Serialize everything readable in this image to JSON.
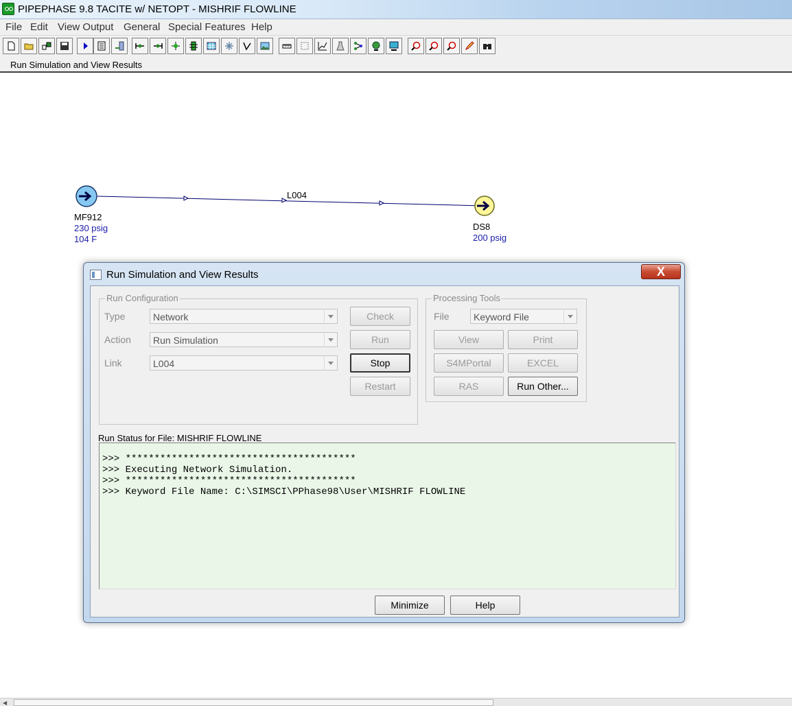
{
  "window": {
    "title": "PIPEPHASE 9.8 TACITE w/ NETOPT - MISHRIF FLOWLINE"
  },
  "menu": [
    "File",
    "Edit",
    "View Output",
    "General",
    "Special Features",
    "Help"
  ],
  "toolbar_icons": [
    "new-file-icon",
    "open-folder-icon",
    "network-icon",
    "save-icon",
    "run-arrow-icon",
    "document-icon",
    "exchange-icon",
    "source-link-icon",
    "sink-link-icon",
    "junction-icon",
    "separator-icon",
    "table-icon",
    "snowflake-icon",
    "link-path-icon",
    "image-icon",
    "ruler-icon",
    "grid-icon",
    "plot-icon",
    "flask-icon",
    "nodes-icon",
    "globe-icon",
    "monitor-icon",
    "zoom-in-icon",
    "zoom-out-icon",
    "zoom-fit-icon",
    "pencil-icon",
    "binoculars-icon"
  ],
  "strip": {
    "label": "Run Simulation and View Results"
  },
  "canvas": {
    "source": {
      "name": "MF912",
      "pressure": "230 psig",
      "temperature": "104 F"
    },
    "link": {
      "name": "L004"
    },
    "sink": {
      "name": "DS8",
      "pressure": "200 psig"
    }
  },
  "dialog": {
    "title": "Run Simulation and View Results",
    "close_label": "X",
    "run_config": {
      "title": "Run Configuration",
      "type_label": "Type",
      "type_value": "Network",
      "action_label": "Action",
      "action_value": "Run Simulation",
      "link_label": "Link",
      "link_value": "L004",
      "check_label": "Check",
      "run_label": "Run",
      "stop_label": "Stop",
      "restart_label": "Restart"
    },
    "processing": {
      "title": "Processing Tools",
      "file_label": "File",
      "file_value": "Keyword File",
      "view_label": "View",
      "print_label": "Print",
      "s4m_label": "S4MPortal",
      "excel_label": "EXCEL",
      "ras_label": "RAS",
      "run_other_label": "Run Other..."
    },
    "run_status_label": "Run Status for File: MISHRIF FLOWLINE",
    "output_lines": [
      ">>> ****************************************",
      ">>> Executing Network Simulation.",
      ">>> ****************************************",
      ">>> Keyword File Name: C:\\SIMSCI\\PPhase98\\User\\MISHRIF FLOWLINE"
    ],
    "minimize_label": "Minimize",
    "help_label": "Help"
  },
  "colors": {
    "dialog_frame": "#c3d8ee",
    "output_bg": "#eaf7e8",
    "node_value": "#1a1aa8",
    "link_line": "#00006e"
  }
}
